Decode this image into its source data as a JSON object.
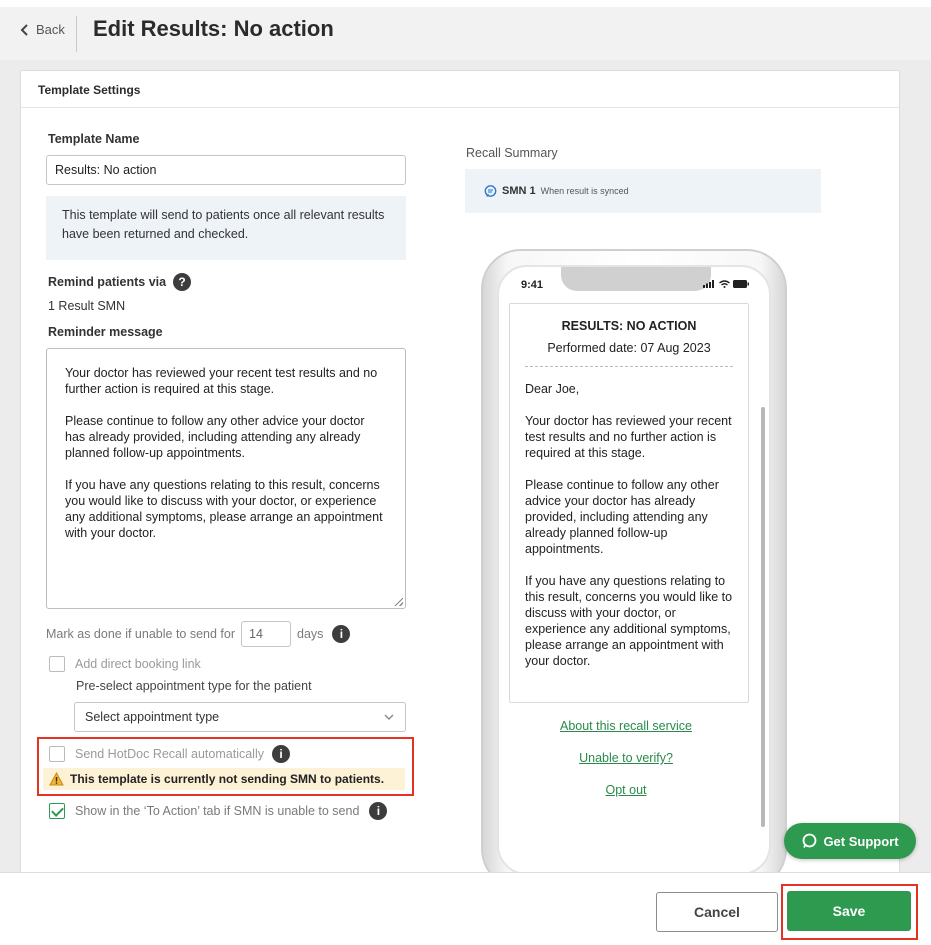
{
  "header": {
    "back_label": "Back",
    "title": "Edit Results: No action"
  },
  "card": {
    "title": "Template Settings"
  },
  "form": {
    "template_name_label": "Template Name",
    "template_name_value": "Results: No action",
    "info_text": "This template will send to patients once all relevant results have been returned and checked.",
    "remind_label": "Remind patients via",
    "remind_value": "1 Result SMN",
    "reminder_message_label": "Reminder message",
    "reminder_message": [
      "Your doctor has reviewed your recent test results and no further action is required at this stage.",
      "Please continue to follow any other advice your doctor has already provided, including attending any already planned follow-up appointments.",
      "If you have any questions relating to this result, concerns you would like to discuss with your doctor, or experience any additional symptoms, please arrange an appointment with your doctor."
    ],
    "mark_done_prefix": "Mark as done if unable to send for",
    "mark_done_days": "14",
    "mark_done_suffix": "days",
    "booking_link_label": "Add direct booking link",
    "booking_link_checked": false,
    "preselect_label": "Pre-select appointment type for the patient",
    "appointment_select_placeholder": "Select appointment type",
    "send_auto_label": "Send HotDoc Recall automatically",
    "send_auto_checked": false,
    "warning_text": "This template is currently not sending SMN to patients.",
    "show_todo_label": "Show in the ‘To Action’ tab if SMN is unable to send",
    "show_todo_checked": true
  },
  "recall_summary": {
    "label": "Recall Summary",
    "item_name": "SMN 1",
    "item_detail": "When result is synced"
  },
  "phone": {
    "time": "9:41",
    "msg_title": "RESULTS: NO ACTION",
    "msg_date": "Performed date: 07 Aug 2023",
    "greeting": "Dear Joe,",
    "paragraphs": [
      "Your doctor has reviewed your recent test results and no further action is required at this stage.",
      "Please continue to follow any other advice your doctor has already provided, including attending any already planned follow-up appointments.",
      "If you have any questions relating to this result, concerns you would like to discuss with your doctor, or experience any additional symptoms, please arrange an appointment with your doctor."
    ],
    "links": [
      "About this recall service",
      "Unable to verify?",
      "Opt out"
    ]
  },
  "support_label": "Get Support",
  "footer": {
    "cancel_label": "Cancel",
    "save_label": "Save"
  },
  "colors": {
    "primary_green": "#2e9a4f",
    "highlight_red": "#e53222",
    "info_bg": "#eef3f8",
    "warning_bg": "#fdf2d6"
  }
}
